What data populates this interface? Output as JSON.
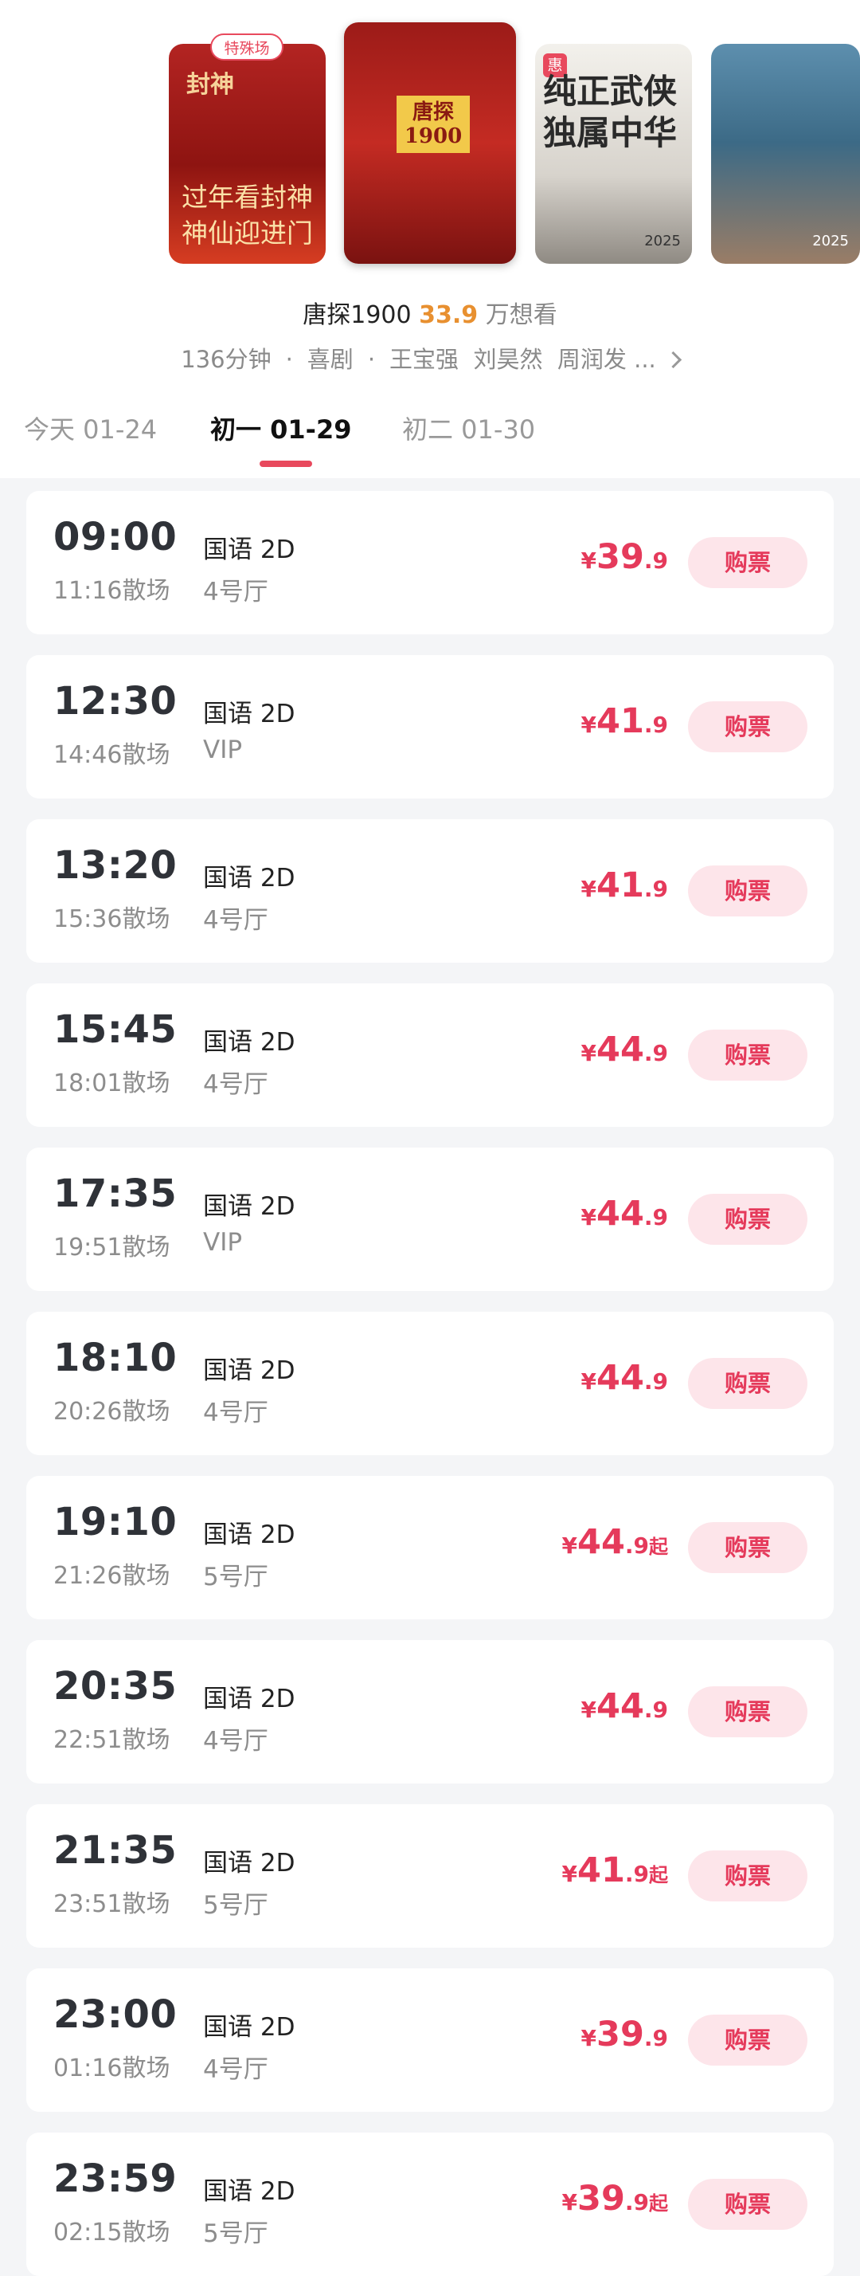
{
  "posters": [
    {
      "tag": "特殊场",
      "title": "封神",
      "tagline_1": "过年看封神",
      "tagline_2": "神仙迎进门"
    },
    {
      "title": "唐探1900"
    },
    {
      "badge": "惠",
      "title": "纯正武侠独属中华",
      "year": "2025"
    },
    {
      "year": "2025"
    }
  ],
  "movie": {
    "name": "唐探1900",
    "views_number": "33.9",
    "views_unit": "万想看",
    "duration": "136分钟",
    "genre": "喜剧",
    "cast": "王宝强  刘昊然  周润发 ..."
  },
  "date_tabs": [
    {
      "label": "今天 01-24"
    },
    {
      "label": "初一 01-29",
      "selected": true
    },
    {
      "label": "初二 01-30"
    }
  ],
  "shows": [
    {
      "start": "09:00",
      "end": "11:16散场",
      "lang": "国语 2D",
      "hall": "4号厅",
      "currency": "¥",
      "price_int": "39",
      "price_dec": ".9",
      "suffix": ""
    },
    {
      "start": "12:30",
      "end": "14:46散场",
      "lang": "国语 2D",
      "hall": "VIP",
      "currency": "¥",
      "price_int": "41",
      "price_dec": ".9",
      "suffix": ""
    },
    {
      "start": "13:20",
      "end": "15:36散场",
      "lang": "国语 2D",
      "hall": "4号厅",
      "currency": "¥",
      "price_int": "41",
      "price_dec": ".9",
      "suffix": ""
    },
    {
      "start": "15:45",
      "end": "18:01散场",
      "lang": "国语 2D",
      "hall": "4号厅",
      "currency": "¥",
      "price_int": "44",
      "price_dec": ".9",
      "suffix": ""
    },
    {
      "start": "17:35",
      "end": "19:51散场",
      "lang": "国语 2D",
      "hall": "VIP",
      "currency": "¥",
      "price_int": "44",
      "price_dec": ".9",
      "suffix": ""
    },
    {
      "start": "18:10",
      "end": "20:26散场",
      "lang": "国语 2D",
      "hall": "4号厅",
      "currency": "¥",
      "price_int": "44",
      "price_dec": ".9",
      "suffix": ""
    },
    {
      "start": "19:10",
      "end": "21:26散场",
      "lang": "国语 2D",
      "hall": "5号厅",
      "currency": "¥",
      "price_int": "44",
      "price_dec": ".9",
      "suffix": "起"
    },
    {
      "start": "20:35",
      "end": "22:51散场",
      "lang": "国语 2D",
      "hall": "4号厅",
      "currency": "¥",
      "price_int": "44",
      "price_dec": ".9",
      "suffix": ""
    },
    {
      "start": "21:35",
      "end": "23:51散场",
      "lang": "国语 2D",
      "hall": "5号厅",
      "currency": "¥",
      "price_int": "41",
      "price_dec": ".9",
      "suffix": "起"
    },
    {
      "start": "23:00",
      "end": "01:16散场",
      "lang": "国语 2D",
      "hall": "4号厅",
      "currency": "¥",
      "price_int": "39",
      "price_dec": ".9",
      "suffix": ""
    },
    {
      "start": "23:59",
      "end": "02:15散场",
      "lang": "国语 2D",
      "hall": "5号厅",
      "currency": "¥",
      "price_int": "39",
      "price_dec": ".9",
      "suffix": "起"
    }
  ],
  "buy_label": "购票",
  "colors": {
    "accent": "#e53a5b",
    "buy_bg": "#fde5ea",
    "views": "#e89030",
    "page_bg": "#f4f5f7"
  }
}
